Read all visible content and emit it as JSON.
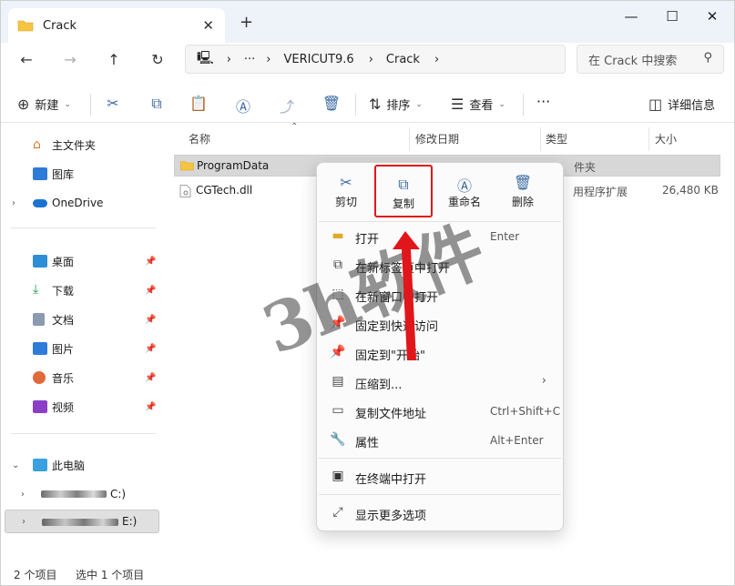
{
  "window": {
    "tab_title": "Crack",
    "new_tab": "+",
    "controls": {
      "minimize": "—",
      "maximize": "☐",
      "close": "✕"
    }
  },
  "address_bar": {
    "more": "···",
    "crumbs": [
      "VERICUT9.6",
      "Crack"
    ],
    "search_placeholder": "在 Crack 中搜索"
  },
  "toolbar": {
    "new_label": "新建",
    "sort_label": "排序",
    "view_label": "查看",
    "more": "···",
    "details_label": "详细信息"
  },
  "sidebar": {
    "top_items": [
      {
        "label": "主文件夹"
      },
      {
        "label": "图库"
      },
      {
        "label": "OneDrive"
      }
    ],
    "pinned": [
      {
        "label": "桌面"
      },
      {
        "label": "下载"
      },
      {
        "label": "文档"
      },
      {
        "label": "图片"
      },
      {
        "label": "音乐"
      },
      {
        "label": "视频"
      }
    ],
    "this_pc": "此电脑",
    "drive1_suffix": "C:)",
    "drive2_suffix": "E:)"
  },
  "columns": {
    "name": "名称",
    "modified": "修改日期",
    "type": "类型",
    "size": "大小"
  },
  "files": [
    {
      "name": "ProgramData",
      "type": "件夹",
      "size": ""
    },
    {
      "name": "CGTech.dll",
      "type": "用程序扩展",
      "size": "26,480 KB"
    }
  ],
  "context_menu": {
    "top_actions": [
      {
        "label": "剪切",
        "icon": "scissors-icon"
      },
      {
        "label": "复制",
        "icon": "copy-icon"
      },
      {
        "label": "重命名",
        "icon": "rename-icon"
      },
      {
        "label": "删除",
        "icon": "trash-icon"
      }
    ],
    "items": [
      {
        "label": "打开",
        "shortcut": "Enter"
      },
      {
        "label": "在新标签页中打开",
        "shortcut": ""
      },
      {
        "label": "在新窗口中打开",
        "shortcut": ""
      },
      {
        "label": "固定到快速访问",
        "shortcut": ""
      },
      {
        "label": "固定到\"开始\"",
        "shortcut": ""
      },
      {
        "label": "压缩到...",
        "shortcut": ""
      },
      {
        "label": "复制文件地址",
        "shortcut": "Ctrl+Shift+C"
      },
      {
        "label": "属性",
        "shortcut": "Alt+Enter"
      },
      {
        "label": "在终端中打开",
        "shortcut": ""
      },
      {
        "label": "显示更多选项",
        "shortcut": ""
      }
    ]
  },
  "status": {
    "count": "2 个项目",
    "selected": "选中 1 个项目"
  },
  "watermark": "3h软件",
  "colors": {
    "accent": "#3b6aa0",
    "highlight_red": "#e0161b",
    "folder": "#f5c542"
  }
}
